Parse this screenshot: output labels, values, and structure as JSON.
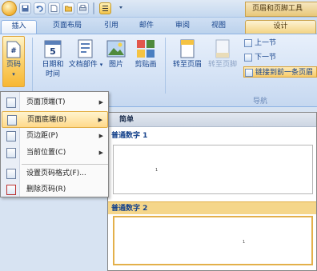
{
  "context_tab_title": "页眉和页脚工具",
  "tabs": [
    {
      "label": "插入"
    },
    {
      "label": "页面布局"
    },
    {
      "label": "引用"
    },
    {
      "label": "邮件"
    },
    {
      "label": "审阅"
    },
    {
      "label": "视图"
    },
    {
      "label": "设计"
    }
  ],
  "ribbon": {
    "page_number": "页码",
    "date_time_1": "日期和",
    "date_time_2": "时间",
    "doc_parts": "文档部件",
    "picture": "图片",
    "clip_art": "剪贴画",
    "goto_header": "转至页眉",
    "goto_footer": "转至页脚",
    "prev_section": "上一节",
    "next_section": "下一节",
    "link_previous": "链接到前一条页眉",
    "nav_group_label": "导航"
  },
  "menu": {
    "items": [
      {
        "label": "页面顶端(T)"
      },
      {
        "label": "页面底端(B)"
      },
      {
        "label": "页边距(P)"
      },
      {
        "label": "当前位置(C)"
      },
      {
        "label": "设置页码格式(F)..."
      },
      {
        "label": "删除页码(R)"
      }
    ]
  },
  "gallery": {
    "header": "简单",
    "item1_title": "普通数字 1",
    "item2_title": "普通数字 2",
    "sample_number": "1"
  },
  "colors": {
    "ribbon_text": "#15428b",
    "highlight": "#ffd98a",
    "context_tab": "#e8c77a"
  }
}
